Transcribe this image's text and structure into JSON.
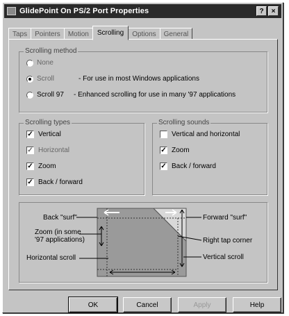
{
  "window": {
    "title": "GlidePoint On PS/2 Port Properties",
    "help_btn": "?",
    "close_btn": "×"
  },
  "tabs": [
    "Taps",
    "Pointers",
    "Motion",
    "Scrolling",
    "Options",
    "General"
  ],
  "active_tab": "Scrolling",
  "scrolling_method": {
    "title": "Scrolling method",
    "options": [
      {
        "label": "None",
        "desc": "",
        "selected": false
      },
      {
        "label": "Scroll",
        "desc": "- For use in most Windows applications",
        "selected": true
      },
      {
        "label": "Scroll 97",
        "desc": "- Enhanced scrolling for use in many '97 applications",
        "selected": false
      }
    ]
  },
  "scrolling_types": {
    "title": "Scrolling types",
    "items": [
      {
        "label": "Vertical",
        "checked": true,
        "enabled": true
      },
      {
        "label": "Horizontal",
        "checked": true,
        "enabled": false
      },
      {
        "label": "Zoom",
        "checked": true,
        "enabled": true
      },
      {
        "label": "Back / forward",
        "checked": true,
        "enabled": true
      }
    ]
  },
  "scrolling_sounds": {
    "title": "Scrolling sounds",
    "items": [
      {
        "label": "Vertical and horizontal",
        "checked": false
      },
      {
        "label": "Zoom",
        "checked": true
      },
      {
        "label": "Back / forward",
        "checked": true
      }
    ]
  },
  "diagram": {
    "back_surf": "Back \"surf\"",
    "zoom_line1": "Zoom (in some",
    "zoom_line2": "'97 applications)",
    "horizontal_scroll": "Horizontal scroll",
    "forward_surf": "Forward \"surf\"",
    "right_tap_corner": "Right tap corner",
    "vertical_scroll": "Vertical scroll"
  },
  "buttons": {
    "ok": "OK",
    "cancel": "Cancel",
    "apply": "Apply",
    "help": "Help"
  }
}
